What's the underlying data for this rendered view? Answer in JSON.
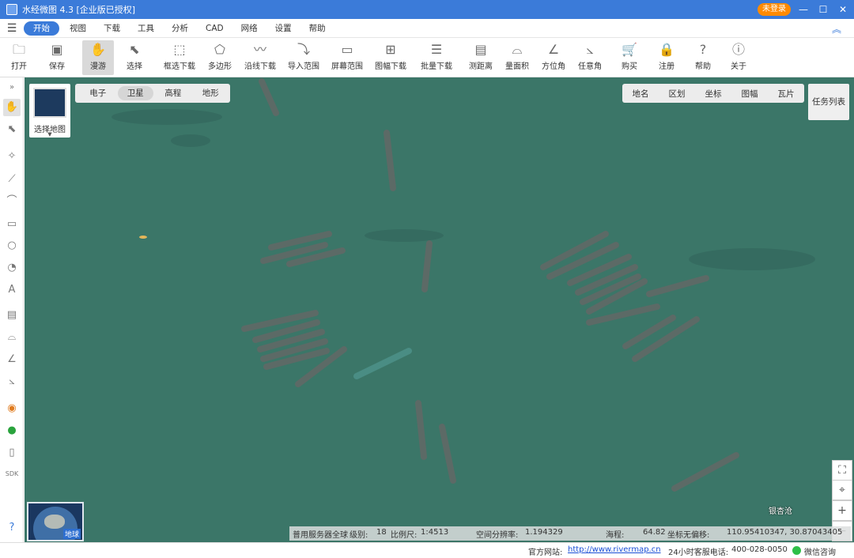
{
  "window": {
    "title": "水经微图 4.3 [企业版已授权]",
    "login_label": "未登录",
    "min": "—",
    "max": "☐",
    "close": "✕"
  },
  "menu": {
    "items": [
      "开始",
      "视图",
      "下载",
      "工具",
      "分析",
      "CAD",
      "网络",
      "设置",
      "帮助"
    ],
    "active_index": 0
  },
  "toolbar": {
    "items": [
      {
        "label": "打开",
        "icon": "folder-icon"
      },
      {
        "label": "保存",
        "icon": "save-icon"
      },
      {
        "label": "漫游",
        "icon": "hand-icon"
      },
      {
        "label": "选择",
        "icon": "cursor-icon"
      },
      {
        "label": "框选下载",
        "icon": "rect-download-icon"
      },
      {
        "label": "多边形",
        "icon": "polygon-icon"
      },
      {
        "label": "沿线下载",
        "icon": "line-download-icon"
      },
      {
        "label": "导入范围",
        "icon": "import-range-icon"
      },
      {
        "label": "屏幕范围",
        "icon": "screen-range-icon"
      },
      {
        "label": "图幅下载",
        "icon": "sheet-download-icon"
      },
      {
        "label": "批量下载",
        "icon": "batch-download-icon"
      },
      {
        "label": "测距离",
        "icon": "ruler-icon"
      },
      {
        "label": "量面积",
        "icon": "area-icon"
      },
      {
        "label": "方位角",
        "icon": "azimuth-icon"
      },
      {
        "label": "任意角",
        "icon": "angle-icon"
      },
      {
        "label": "购买",
        "icon": "cart-icon"
      },
      {
        "label": "注册",
        "icon": "lock-icon"
      },
      {
        "label": "帮助",
        "icon": "help-icon"
      },
      {
        "label": "关于",
        "icon": "info-icon"
      }
    ]
  },
  "map": {
    "layer_picker_label": "选择地图",
    "tabs_left": [
      "电子",
      "卫星",
      "高程",
      "地形"
    ],
    "active_left_tab": 1,
    "tabs_right": [
      "地名",
      "区划",
      "坐标",
      "图幅",
      "瓦片"
    ],
    "task_list": "任务列表",
    "globe_label": "地球",
    "place_label": "银杏沧"
  },
  "status": {
    "server": "普用服务器全球",
    "level_label": "级别:",
    "level": "18",
    "scale_label": "比例尺:",
    "scale": "1:4513",
    "resolution_label": "空间分辨率:",
    "resolution": "1.194329",
    "elevation_label": "海程:",
    "elevation": "64.82",
    "coord_label": "坐标无偏移:",
    "coords": "110.95410347, 30.87043405"
  },
  "footer": {
    "site_label": "官方网站:",
    "site_url": "http://www.rivermap.cn",
    "hotline_label": "24小时客服电话:",
    "hotline": "400-028-0050",
    "wechat": "微信咨询"
  }
}
